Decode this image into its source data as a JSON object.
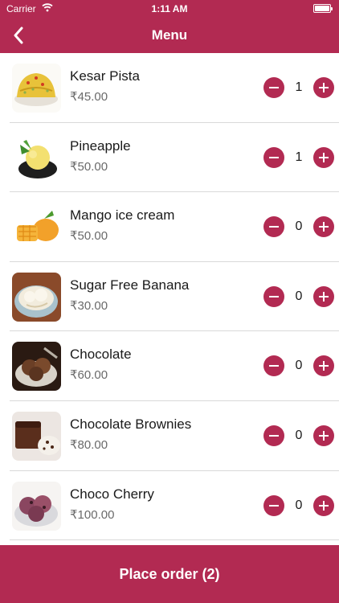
{
  "status_bar": {
    "carrier": "Carrier",
    "time": "1:11 AM"
  },
  "nav": {
    "title": "Menu",
    "back_icon": "chevron-left-icon"
  },
  "items": [
    {
      "name": "Kesar Pista",
      "price": "₹45.00",
      "qty": "1"
    },
    {
      "name": "Pineapple",
      "price": "₹50.00",
      "qty": "1"
    },
    {
      "name": "Mango ice cream",
      "price": "₹50.00",
      "qty": "0"
    },
    {
      "name": "Sugar Free Banana",
      "price": "₹30.00",
      "qty": "0"
    },
    {
      "name": "Chocolate",
      "price": "₹60.00",
      "qty": "0"
    },
    {
      "name": "Chocolate Brownies",
      "price": "₹80.00",
      "qty": "0"
    },
    {
      "name": "Choco Cherry",
      "price": "₹100.00",
      "qty": "0"
    }
  ],
  "order_button": {
    "label": "Place order (2)"
  },
  "colors": {
    "accent": "#b22a52",
    "divider": "#d9d9d9",
    "price": "#6a6a6a"
  }
}
